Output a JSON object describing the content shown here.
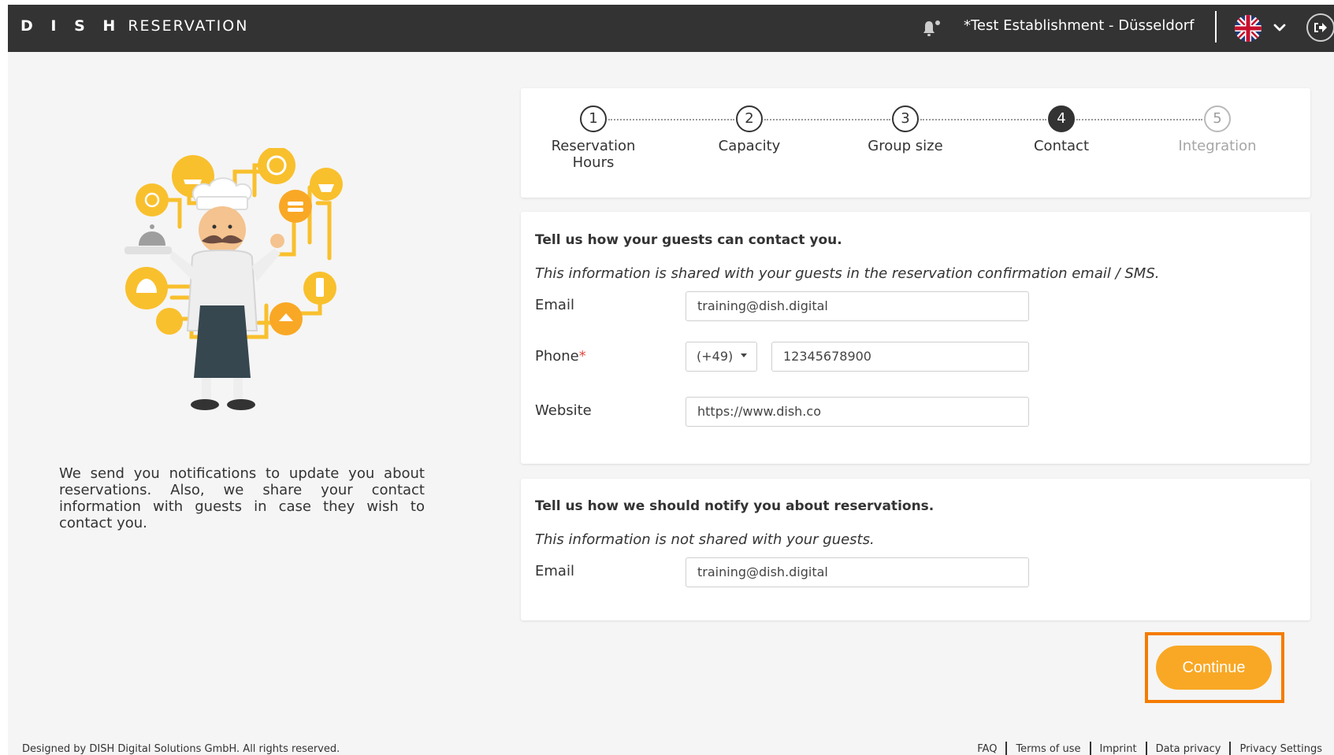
{
  "header": {
    "logo_brand": "D I S H",
    "logo_word": "RESERVATION",
    "establishment": "*Test Establishment - Düsseldorf",
    "icons": {
      "notifications": "bell-icon",
      "language": "uk-flag-icon",
      "expand": "chevron-down-icon",
      "logout": "logout-icon"
    }
  },
  "left": {
    "illustration": "chef-illustration",
    "description": "We send you notifications to update you about reservations. Also, we share your contact information with guests in case they wish to contact you."
  },
  "steps": [
    {
      "number": "1",
      "label": "Reservation Hours",
      "state": "done"
    },
    {
      "number": "2",
      "label": "Capacity",
      "state": "done"
    },
    {
      "number": "3",
      "label": "Group size",
      "state": "done"
    },
    {
      "number": "4",
      "label": "Contact",
      "state": "active"
    },
    {
      "number": "5",
      "label": "Integration",
      "state": "disabled"
    }
  ],
  "contact": {
    "title": "Tell us how your guests can contact you.",
    "note": "This information is shared with your guests in the reservation confirmation email / SMS.",
    "email_label": "Email",
    "email_value": "training@dish.digital",
    "phone_label": "Phone",
    "phone_required": "*",
    "phone_code": "(+49)",
    "phone_number": "12345678900",
    "website_label": "Website",
    "website_value": "https://www.dish.co"
  },
  "notify": {
    "title": "Tell us how we should notify you about reservations.",
    "note": "This information is not shared with your guests.",
    "email_label": "Email",
    "email_value": "training@dish.digital"
  },
  "actions": {
    "continue_label": "Continue"
  },
  "footer": {
    "copyright": "Designed by DISH Digital Solutions GmbH. All rights reserved.",
    "links": [
      "FAQ",
      "Terms of use",
      "Imprint",
      "Data privacy",
      "Privacy Settings"
    ]
  },
  "colors": {
    "topbar": "#333333",
    "accent": "#f9a825",
    "highlight": "#f57c00",
    "required": "#e34a3f",
    "page_bg": "#f5f5f5"
  }
}
